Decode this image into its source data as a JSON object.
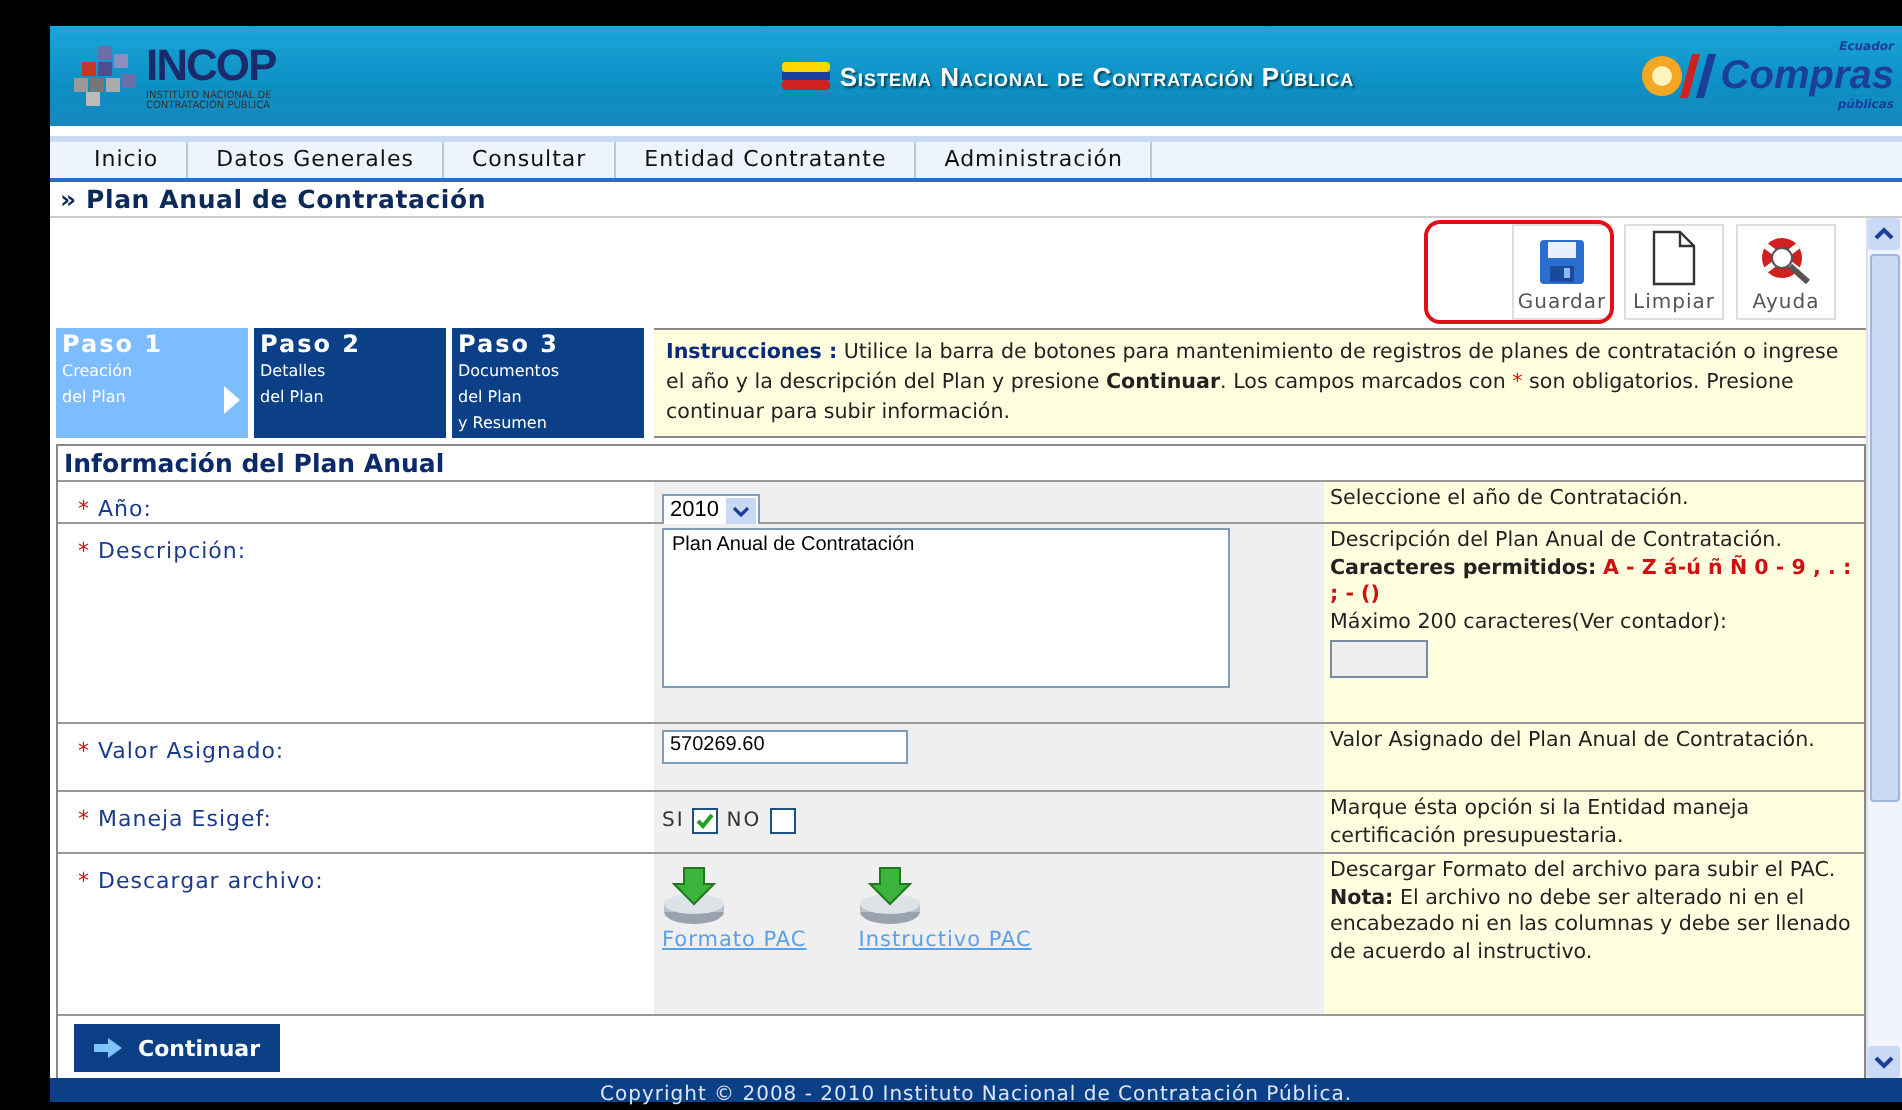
{
  "header": {
    "logo_text": "INCOP",
    "logo_subtitle": [
      "INSTITUTO NACIONAL DE",
      "CONTRATACIÓN PÚBLICA"
    ],
    "title": "Sistema Nacional de Contratación Pública",
    "brand": "Compras",
    "brand_top": "Ecuador",
    "brand_bottom": "públicas"
  },
  "nav": [
    {
      "label": "Inicio"
    },
    {
      "label": "Datos Generales"
    },
    {
      "label": "Consultar"
    },
    {
      "label": "Entidad Contratante"
    },
    {
      "label": "Administración"
    }
  ],
  "page_title": "» Plan Anual de Contratación",
  "toolbar": [
    {
      "label": "Guardar",
      "kind": "save",
      "highlighted": true
    },
    {
      "label": "Limpiar",
      "kind": "clear",
      "highlighted": false
    },
    {
      "label": "Ayuda",
      "kind": "help",
      "highlighted": false
    }
  ],
  "steps": [
    {
      "title": "Paso 1",
      "lines": [
        "Creación",
        "del Plan"
      ],
      "selected": true
    },
    {
      "title": "Paso 2",
      "lines": [
        "Detalles",
        "del Plan"
      ],
      "selected": false
    },
    {
      "title": "Paso 3",
      "lines": [
        "Documentos",
        "del Plan",
        "y Resumen"
      ],
      "selected": false
    }
  ],
  "instructions": {
    "label": "Instrucciones :",
    "text": "Utilice la barra de botones para mantenimiento de registros de planes de contratación o ingrese el año y la descripción del Plan y presione **Continuar**. Los campos marcados con",
    "mark": "*",
    "text_after": "son obligatorios. Presione continuar para subir información."
  },
  "section_title": "Información del Plan Anual",
  "rows": [
    {
      "kind": "select",
      "label": "Año:",
      "required": true,
      "value": "2010",
      "help": [
        {
          "kind": "text",
          "text": "Seleccione el año de Contratación."
        }
      ]
    },
    {
      "kind": "textarea",
      "label": "Descripción:",
      "required": true,
      "value": "Plan Anual de Contratación",
      "help": [
        {
          "kind": "text",
          "text": "Descripción del Plan Anual de Contratación."
        },
        {
          "kind": "allowed",
          "label": "Caracteres permitidos:",
          "value": "A - Z á-ú ñ Ñ 0 - 9 , . : ; - ()"
        },
        {
          "kind": "text",
          "text": "Máximo 200 caracteres(Ver contador):"
        },
        {
          "kind": "counter"
        }
      ]
    },
    {
      "kind": "input",
      "label": "Valor Asignado:",
      "required": true,
      "value": "570269.60",
      "help": [
        {
          "kind": "text",
          "text": "Valor Asignado del Plan Anual de Contratación."
        }
      ]
    },
    {
      "kind": "checkboxes",
      "label": "Maneja Esigef:",
      "required": true,
      "options": [
        {
          "label": "SI",
          "checked": true
        },
        {
          "label": "NO",
          "checked": false
        }
      ],
      "help": [
        {
          "kind": "text",
          "text": "Marque ésta opción si la Entidad maneja certificación presupuestaria."
        }
      ]
    },
    {
      "kind": "downloads",
      "label": "Descargar archivo:",
      "required": true,
      "links": [
        {
          "label": "Formato PAC"
        },
        {
          "label": "Instructivo PAC"
        }
      ],
      "help": [
        {
          "kind": "text",
          "text": "Descargar Formato del archivo para subir el PAC."
        },
        {
          "kind": "text",
          "text": "**Nota:** El archivo no debe ser alterado ni en el encabezado ni en las columnas y debe ser llenado de acuerdo al instructivo."
        }
      ]
    }
  ],
  "continue_button": "Continuar",
  "footer": "Copyright © 2008 - 2010 Instituto Nacional de Contratación Pública."
}
